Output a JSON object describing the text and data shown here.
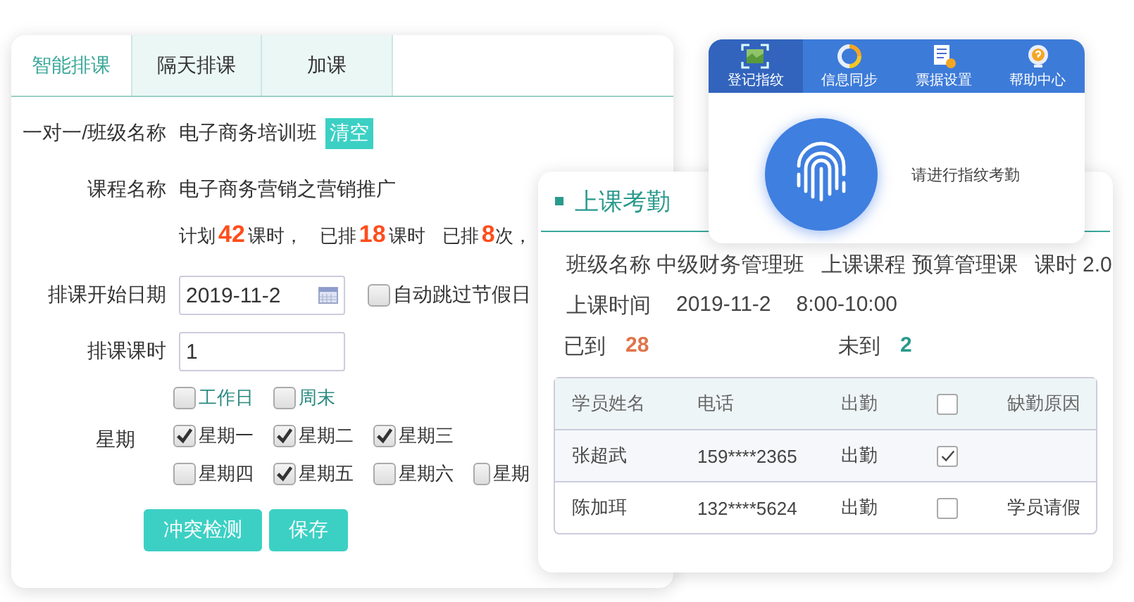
{
  "schedule_panel": {
    "tabs": [
      {
        "label": "智能排课",
        "selected": true
      },
      {
        "label": "隔天排课",
        "selected": false
      },
      {
        "label": "加课",
        "selected": false
      }
    ],
    "class_label": "一对一/班级名称",
    "class_value": "电子商务培训班",
    "clear_button": "清空",
    "course_label": "课程名称",
    "course_value": "电子商务营销之营销推广",
    "stats": [
      {
        "label": "计划",
        "value": "42",
        "unit": "课时，"
      },
      {
        "label": "已排",
        "value": "18",
        "unit": "课时"
      },
      {
        "label": "已排",
        "value": "8",
        "unit": "次，"
      }
    ],
    "start_date_label": "排课开始日期",
    "start_date": "2019-11-2",
    "skip_holidays": {
      "label": "自动跳过节假日",
      "checked": false
    },
    "hours_label": "排课课时",
    "hours": "1",
    "weekday_label": "星期",
    "quick_picks": [
      {
        "label": "工作日",
        "checked": false
      },
      {
        "label": "周末",
        "checked": false
      }
    ],
    "weekdays": [
      {
        "label": "星期一",
        "checked": true
      },
      {
        "label": "星期二",
        "checked": true
      },
      {
        "label": "星期三",
        "checked": true
      },
      {
        "label": "星期四",
        "checked": false
      },
      {
        "label": "星期五",
        "checked": true
      },
      {
        "label": "星期六",
        "checked": false
      },
      {
        "label": "星期",
        "checked": false
      }
    ],
    "buttons": [
      "冲突检测",
      "保存"
    ]
  },
  "attendance_panel": {
    "title": "上课考勤",
    "info": [
      {
        "label": "班级名称",
        "value": "中级财务管理班"
      },
      {
        "label": "上课课程",
        "value": "预算管理课"
      },
      {
        "label": "课时",
        "value": "2.0"
      }
    ],
    "time_label": "上课时间",
    "date": "2019-11-2",
    "time": "8:00-10:00",
    "arrived_label": "已到",
    "arrived": "28",
    "absent_label": "未到",
    "absent": "2",
    "table": {
      "columns": [
        "学员姓名",
        "电话",
        "出勤",
        "缺勤原因"
      ],
      "all_checked": false,
      "rows": [
        {
          "name": "张超武",
          "phone": "159****2365",
          "status": "出勤",
          "checked": true,
          "reason": ""
        },
        {
          "name": "陈加珥",
          "phone": "132****5624",
          "status": "出勤",
          "checked": false,
          "reason": "学员请假"
        }
      ]
    }
  },
  "fingerprint_window": {
    "toolbar": [
      {
        "label": "登记指纹",
        "selected": true,
        "kind": "scan"
      },
      {
        "label": "信息同步",
        "selected": false,
        "kind": "sync"
      },
      {
        "label": "票据设置",
        "selected": false,
        "kind": "doc"
      },
      {
        "label": "帮助中心",
        "selected": false,
        "kind": "help"
      }
    ],
    "prompt": "请进行指纹考勤"
  }
}
